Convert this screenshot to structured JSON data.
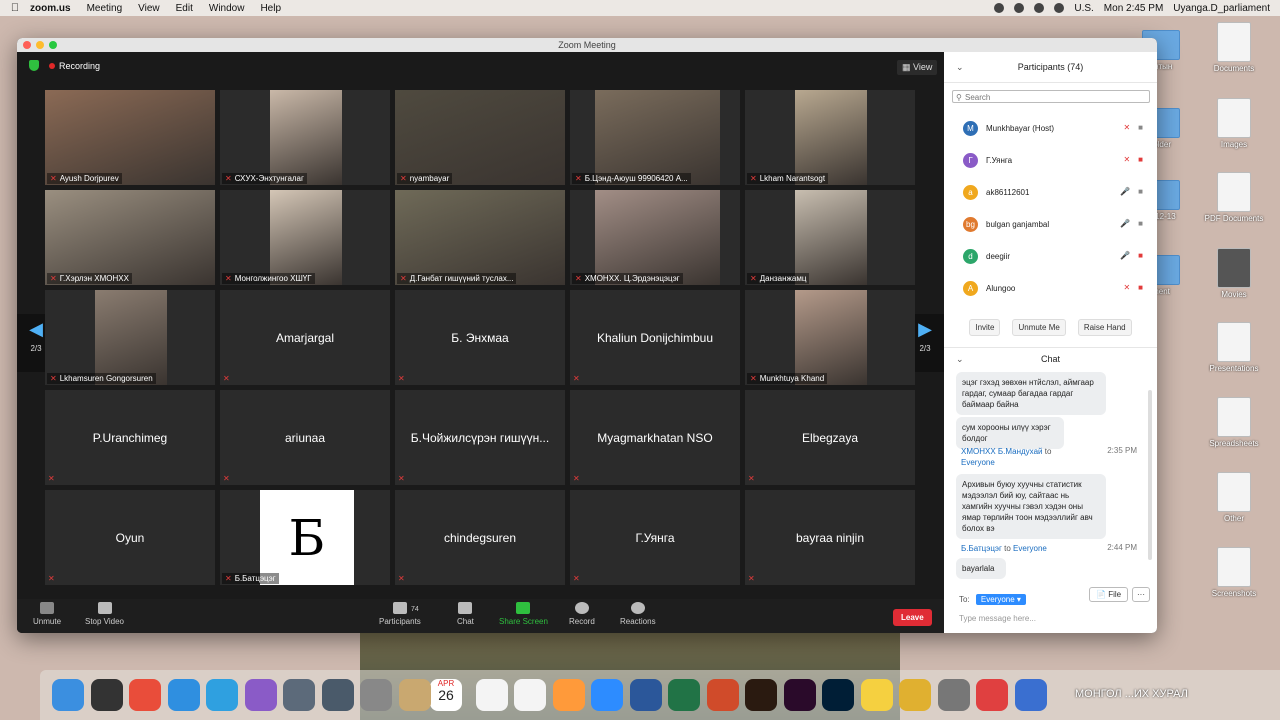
{
  "menubar": {
    "app": "zoom.us",
    "items": [
      "Meeting",
      "View",
      "Edit",
      "Window",
      "Help"
    ],
    "input_source": "U.S.",
    "clock": "Mon 2:45 PM",
    "user": "Uyanga.D_parliament"
  },
  "window": {
    "title": "Zoom Meeting"
  },
  "video": {
    "recording_label": "Recording",
    "view_label": "View",
    "page_left": "2/3",
    "page_right": "2/3",
    "tiles": [
      {
        "name": "Ayush Dorjpurev",
        "kind": "cam"
      },
      {
        "name": "СХУХ-Энхтунгалаг",
        "kind": "cam"
      },
      {
        "name": "nyambayar",
        "kind": "cam"
      },
      {
        "name": "Б.Цэнд-Аюуш 99906420 А...",
        "kind": "cam"
      },
      {
        "name": "Lkham Narantsogt",
        "kind": "cam"
      },
      {
        "name": "Г.Хэрлэн ХМОНХХ",
        "kind": "cam"
      },
      {
        "name": "Монголжингоо ХШҮГ",
        "kind": "cam"
      },
      {
        "name": "Д.Ганбат гишүүний туслах...",
        "kind": "cam"
      },
      {
        "name": "ХМОНХХ. Ц.Эрдэнэцэцэг",
        "kind": "cam"
      },
      {
        "name": "Данзанжамц",
        "kind": "cam"
      },
      {
        "name": "Lkhamsuren Gongorsuren",
        "kind": "cam"
      },
      {
        "name": "Amarjargal",
        "kind": "name"
      },
      {
        "name": "Б. Энхмаа",
        "kind": "name"
      },
      {
        "name": "Khaliun Donijchimbuu",
        "kind": "name"
      },
      {
        "name": "Munkhtuya Khand",
        "kind": "cam"
      },
      {
        "name": "P.Uranchimeg",
        "kind": "name"
      },
      {
        "name": "ariunaa",
        "kind": "name"
      },
      {
        "name": "Б.Чойжилсүрэн гишүүн...",
        "kind": "name"
      },
      {
        "name": "Myagmarkhatan NSO",
        "kind": "name"
      },
      {
        "name": "Elbegzaya",
        "kind": "name"
      },
      {
        "name": "Oyun",
        "kind": "name"
      },
      {
        "name": "Б.Батцэцэг",
        "kind": "letter",
        "letter": "Б"
      },
      {
        "name": "chindegsuren",
        "kind": "name"
      },
      {
        "name": "Г.Уянга",
        "kind": "name"
      },
      {
        "name": "bayraa ninjin",
        "kind": "name"
      }
    ]
  },
  "toolbar": {
    "unmute": "Unmute",
    "stop_video": "Stop Video",
    "participants_count": "74",
    "participants": "Participants",
    "chat": "Chat",
    "share": "Share Screen",
    "record": "Record",
    "reactions": "Reactions",
    "leave": "Leave"
  },
  "participants_panel": {
    "title": "Participants (74)",
    "search_placeholder": "Search",
    "list": [
      {
        "initial": "M",
        "name": "Munkhbayar (Host)",
        "color": "#2f6fb5"
      },
      {
        "initial": "Г",
        "name": "Г.Уянга",
        "color": "#8a5bc7"
      },
      {
        "initial": "a",
        "name": "ak86112601",
        "color": "#f0a81e"
      },
      {
        "initial": "bg",
        "name": "bulgan ganjambal",
        "color": "#e07a2f"
      },
      {
        "initial": "d",
        "name": "deegiir",
        "color": "#2ca66a"
      },
      {
        "initial": "A",
        "name": "Alungoo",
        "color": "#f0a81e"
      }
    ],
    "invite": "Invite",
    "unmute_me": "Unmute Me",
    "raise_hand": "Raise Hand"
  },
  "chat_panel": {
    "title": "Chat",
    "messages": [
      {
        "text": "эцэг гэхэд зөвхөн нтйслэл, аймгаар гардаг, сумаар багадаа гардаг баймаар байна"
      },
      {
        "text": "сум хорооны илүү хэрэг болдог"
      },
      {
        "sender": "ХМОНХХ Б.Мандухай",
        "to": "to",
        "target": "Everyone",
        "time": "2:35 PM",
        "text": "Архивын буюу хуучны статистик мэдээлэл бий юу, сайтаас нь хамгийн хуучны гэвэл хэдэн оны ямар төрлийн тоон мэдээллийг авч болох вэ"
      },
      {
        "sender": "Б.Батцэцэг",
        "to": "to",
        "target": "Everyone",
        "time": "2:44 PM",
        "text": "bayarlala"
      }
    ],
    "to_label": "To:",
    "to_value": "Everyone",
    "file_label": "File",
    "more_label": "···",
    "type_placeholder": "Type message here..."
  },
  "desktop_icons": [
    {
      "label": "Documents"
    },
    {
      "label": "Images"
    },
    {
      "label": "PDF Documents"
    },
    {
      "label": "Movies"
    },
    {
      "label": "Presentations"
    },
    {
      "label": "Spreadsheets"
    },
    {
      "label": "Other"
    },
    {
      "label": "Screenshots"
    }
  ],
  "desktop_left_fragments": [
    "ентын",
    "folder",
    "m 12-13",
    "ment"
  ],
  "dock": {
    "calendar_month": "APR",
    "calendar_day": "26",
    "label": "МОНГОЛ ...ИХ ХУРАЛ"
  }
}
